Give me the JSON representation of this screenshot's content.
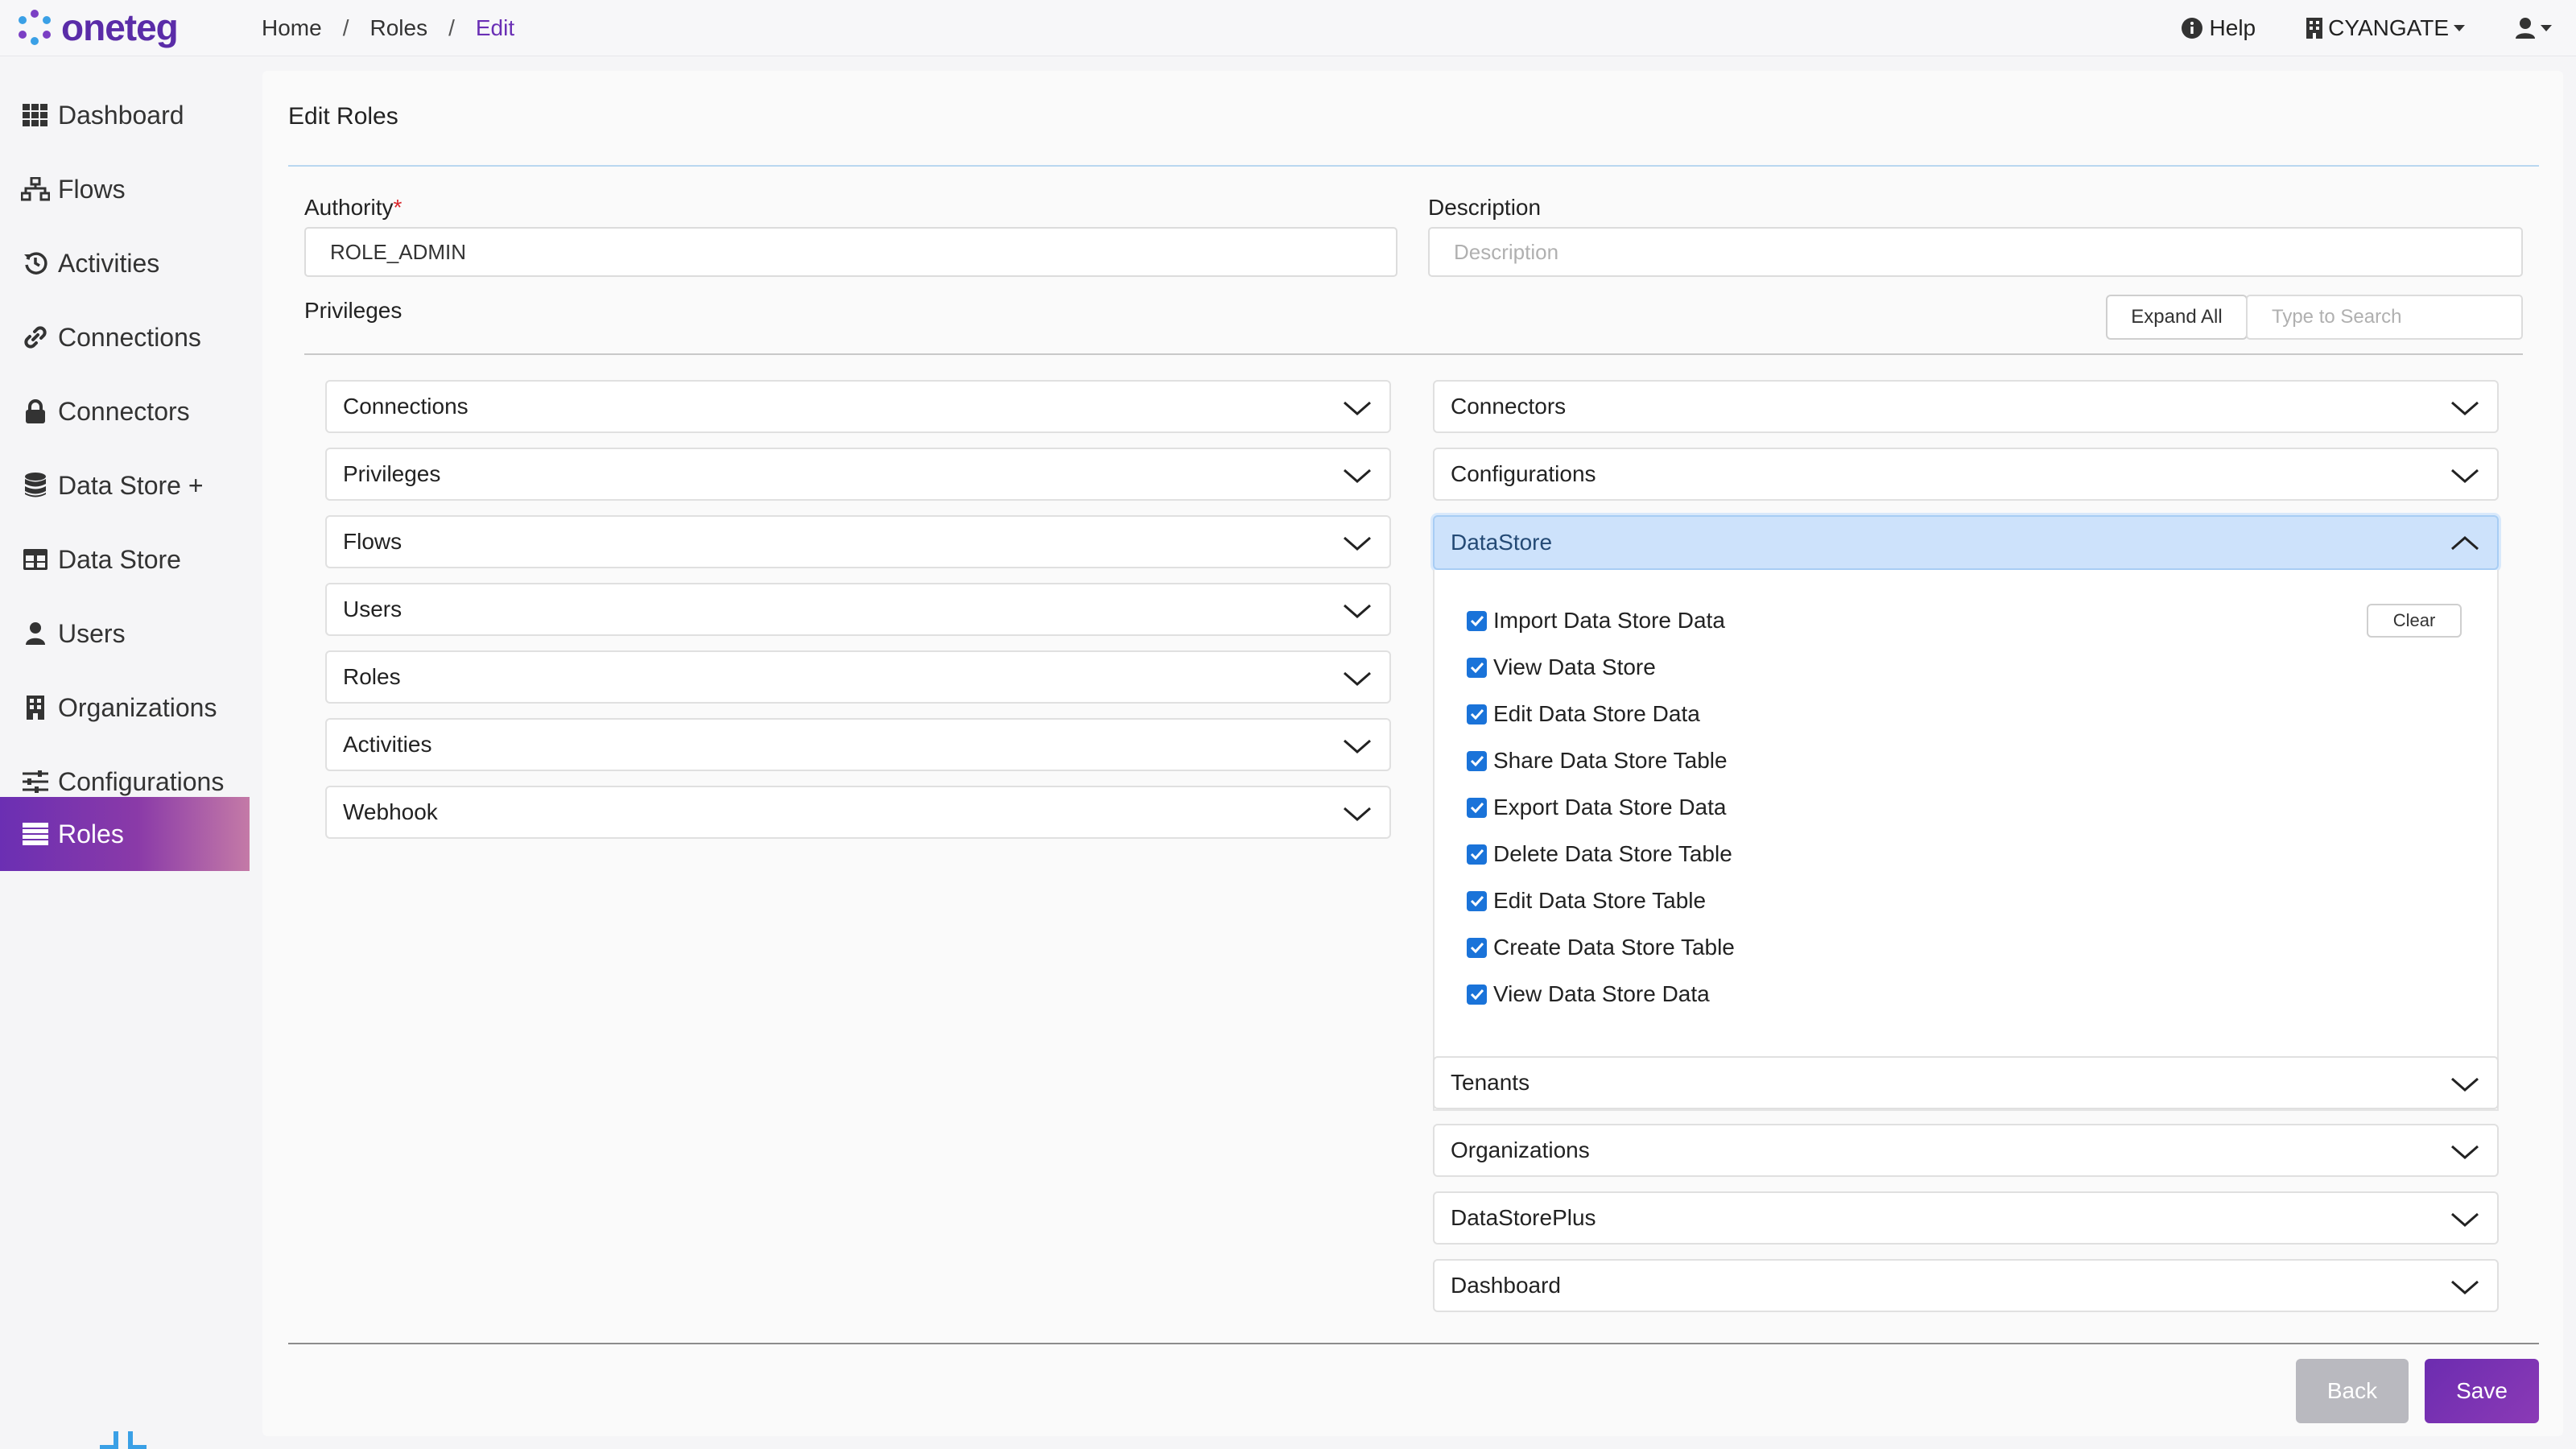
{
  "brand": {
    "name": "oneteg",
    "color": "#5a2ca8"
  },
  "breadcrumb": [
    "Home",
    "Roles",
    "Edit"
  ],
  "header": {
    "help_label": "Help",
    "org_label": "CYANGATE"
  },
  "sidebar": {
    "items": [
      {
        "label": "Dashboard",
        "icon": "grid-icon"
      },
      {
        "label": "Flows",
        "icon": "sitemap-icon"
      },
      {
        "label": "Activities",
        "icon": "history-icon"
      },
      {
        "label": "Connections",
        "icon": "link-icon"
      },
      {
        "label": "Connectors",
        "icon": "lock-icon"
      },
      {
        "label": "Data Store +",
        "icon": "database-icon"
      },
      {
        "label": "Data Store",
        "icon": "table-icon"
      },
      {
        "label": "Users",
        "icon": "user-icon"
      },
      {
        "label": "Organizations",
        "icon": "building-icon"
      },
      {
        "label": "Configurations",
        "icon": "sliders-icon"
      },
      {
        "label": "Roles",
        "icon": "list-icon",
        "active": true
      }
    ],
    "active_gradient": [
      "#6b2fb3",
      "#c47aa7"
    ]
  },
  "form": {
    "title": "Edit Roles",
    "authority_label": "Authority",
    "required_mark": "*",
    "authority_value": "ROLE_ADMIN",
    "description_label": "Description",
    "description_placeholder": "Description",
    "privileges_label": "Privileges",
    "expand_all_label": "Expand All",
    "search_placeholder": "Type to Search"
  },
  "privileges": {
    "left": [
      "Connections",
      "Privileges",
      "Flows",
      "Users",
      "Roles",
      "Activities",
      "Webhook"
    ],
    "right_top": [
      "Connectors",
      "Configurations"
    ],
    "open_group": {
      "label": "DataStore",
      "clear_label": "Clear",
      "items": [
        {
          "label": "Import Data Store Data",
          "checked": true
        },
        {
          "label": "View Data Store",
          "checked": true
        },
        {
          "label": "Edit Data Store Data",
          "checked": true
        },
        {
          "label": "Share Data Store Table",
          "checked": true
        },
        {
          "label": "Export Data Store Data",
          "checked": true
        },
        {
          "label": "Delete Data Store Table",
          "checked": true
        },
        {
          "label": "Edit Data Store Table",
          "checked": true
        },
        {
          "label": "Create Data Store Table",
          "checked": true
        },
        {
          "label": "View Data Store Data",
          "checked": true
        }
      ]
    },
    "right_bottom": [
      "Tenants",
      "Organizations",
      "DataStorePlus",
      "Dashboard"
    ]
  },
  "actions": {
    "back_label": "Back",
    "save_label": "Save"
  },
  "colors": {
    "accent": "#6a2fb5",
    "checkbox": "#1a73d9",
    "open_header": "#cde2fb"
  }
}
